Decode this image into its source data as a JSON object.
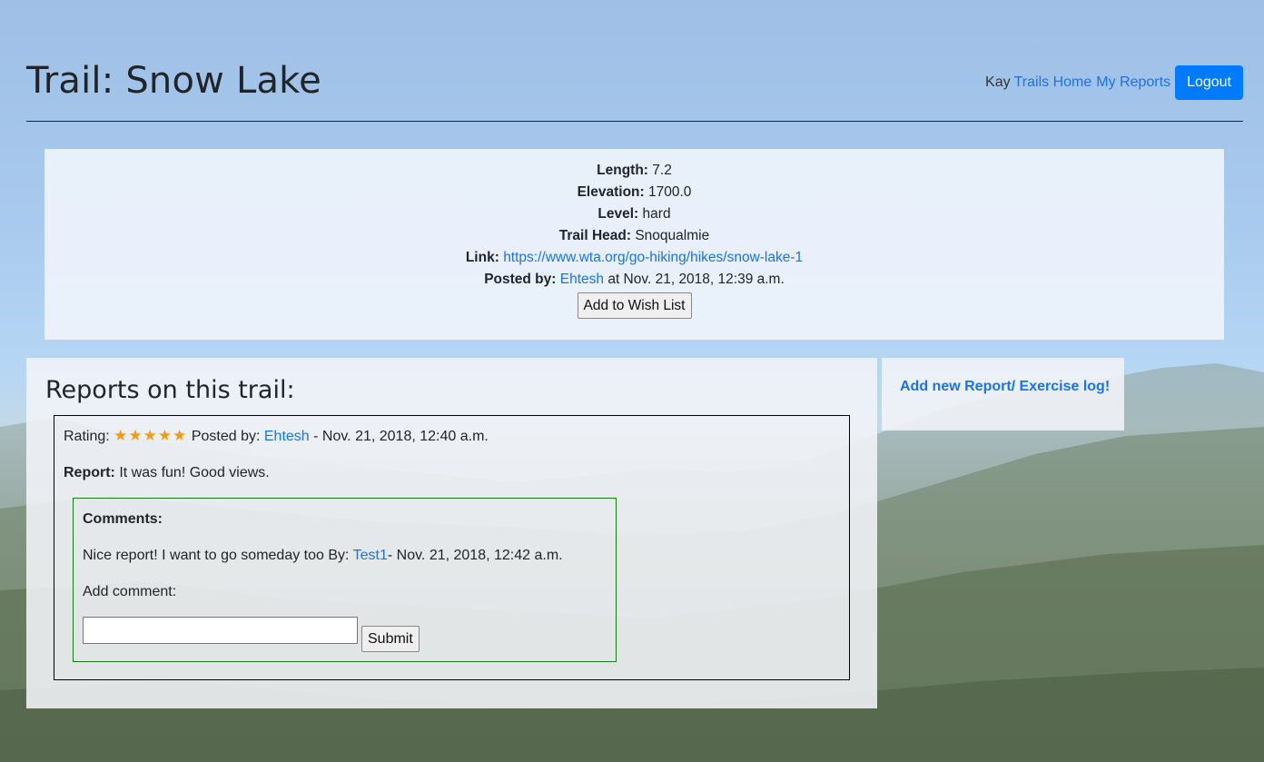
{
  "header": {
    "title": "Trail: Snow Lake",
    "nav": {
      "user": "Kay",
      "trails_home": "Trails Home",
      "my_reports": "My Reports",
      "logout": "Logout"
    }
  },
  "trail": {
    "length_label": "Length:",
    "length_value": "7.2",
    "elevation_label": "Elevation:",
    "elevation_value": "1700.0",
    "level_label": "Level:",
    "level_value": "hard",
    "trailhead_label": "Trail Head:",
    "trailhead_value": "Snoqualmie",
    "link_label": "Link:",
    "link_value": "https://www.wta.org/go-hiking/hikes/snow-lake-1",
    "posted_label": "Posted by:",
    "posted_user": "Ehtesh",
    "posted_time": "at Nov. 21, 2018, 12:39 a.m.",
    "wish_button": "Add to Wish List"
  },
  "reports": {
    "title": "Reports on this trail:",
    "items": [
      {
        "rating_label": "Rating:",
        "stars": "★★★★★",
        "rating": 5,
        "posted_label": "Posted by:",
        "posted_user": "Ehtesh",
        "posted_time": "- Nov. 21, 2018, 12:40 a.m.",
        "report_label": "Report:",
        "report_text": "It was fun! Good views.",
        "comments_title": "Comments:",
        "comments": [
          {
            "text": "Nice report! I want to go someday too By:",
            "user": "Test1",
            "time": "- Nov. 21, 2018, 12:42 a.m."
          }
        ],
        "add_comment_label": "Add comment:",
        "comment_input_value": "",
        "submit_label": "Submit"
      }
    ]
  },
  "sidebar": {
    "add_report_link": "Add new Report/ Exercise log!"
  },
  "colors": {
    "link": "#1a73e8",
    "primary_button": "#007bff",
    "star": "#f49b12",
    "comment_border": "#1a7a1a"
  }
}
